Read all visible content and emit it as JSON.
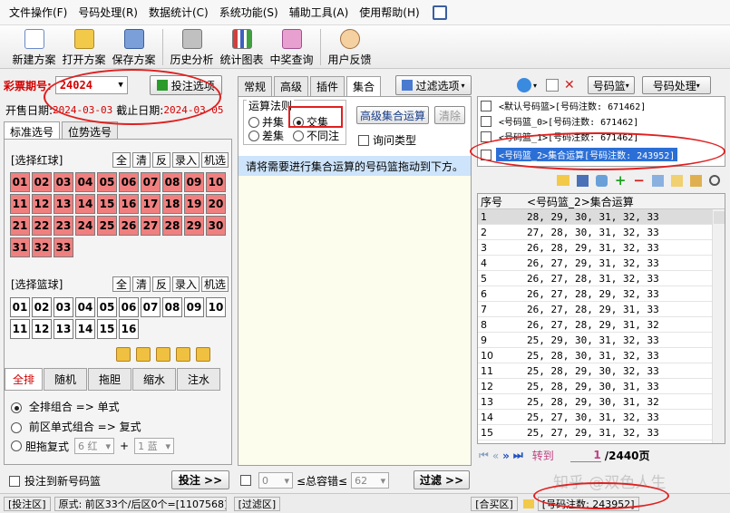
{
  "menu": [
    "文件操作(F)",
    "号码处理(R)",
    "数据统计(C)",
    "系统功能(S)",
    "辅助工具(A)",
    "使用帮助(H)"
  ],
  "toolbar": [
    "新建方案",
    "打开方案",
    "保存方案",
    "历史分析",
    "统计图表",
    "中奖查询",
    "用户反馈"
  ],
  "lottery": {
    "label": "彩票期号:",
    "issue": "24024",
    "button": "投注选项"
  },
  "dates": {
    "open_label": "开售日期:",
    "open_value": "2024-03-03",
    "close_label": "截止日期:",
    "close_value": "2024-03-05"
  },
  "left_tabs": [
    "标准选号",
    "位势选号"
  ],
  "red": {
    "label": "[选择红球]",
    "buttons": [
      "全",
      "清",
      "反",
      "录入",
      "机选"
    ],
    "balls": [
      "01",
      "02",
      "03",
      "04",
      "05",
      "06",
      "07",
      "08",
      "09",
      "10",
      "11",
      "12",
      "13",
      "14",
      "15",
      "16",
      "17",
      "18",
      "19",
      "20",
      "21",
      "22",
      "23",
      "24",
      "25",
      "26",
      "27",
      "28",
      "29",
      "30",
      "31",
      "32",
      "33"
    ]
  },
  "blue": {
    "label": "[选择篮球]",
    "buttons": [
      "全",
      "清",
      "反",
      "录入",
      "机选"
    ],
    "balls": [
      "01",
      "02",
      "03",
      "04",
      "05",
      "06",
      "07",
      "08",
      "09",
      "10",
      "11",
      "12",
      "13",
      "14",
      "15",
      "16"
    ]
  },
  "bottom_tabs": [
    "全排",
    "随机",
    "拖胆",
    "缩水",
    "注水"
  ],
  "options": {
    "opt1": "全排组合 => 单式",
    "opt2": "前区单式组合 => 复式",
    "opt3": "胆拖复式",
    "red_count": "6 红",
    "plus": "+",
    "blue_count": "1 蓝"
  },
  "bet": {
    "checkbox_label": "投注到新号码篮",
    "button": "投注 >>"
  },
  "center_tabs": [
    "常规",
    "高级",
    "插件",
    "集合"
  ],
  "filter_button": "过滤选项",
  "operation": {
    "group_label": "运算法则",
    "union": "并集",
    "intersect": "交集",
    "diff": "差集",
    "distinct": "不同注",
    "advanced_button": "高级集合运算",
    "clear_button": "清除",
    "ask_type": "询问类型",
    "hint": "请将需要进行集合运算的号码篮拖动到下方。"
  },
  "filter_row": {
    "value1": "0",
    "tolerance": "≤总容错≤",
    "value2": "62",
    "button": "过滤 >>"
  },
  "right_toolbar": {
    "basket": "号码篮",
    "process": "号码处理"
  },
  "baskets": [
    "<默认号码篮>[号码注数: 671462]",
    "<号码篮_0>[号码注数: 671462]",
    "<号码篮_1>[号码注数: 671462]",
    "<号码篮_2>集合运算[号码注数: 243952]"
  ],
  "table": {
    "head_no": "序号",
    "head_name": "<号码篮_2>集合运算",
    "rows": [
      [
        "1",
        "28, 29, 30, 31, 32, 33"
      ],
      [
        "2",
        "27, 28, 30, 31, 32, 33"
      ],
      [
        "3",
        "26, 28, 29, 31, 32, 33"
      ],
      [
        "4",
        "26, 27, 29, 31, 32, 33"
      ],
      [
        "5",
        "26, 27, 28, 31, 32, 33"
      ],
      [
        "6",
        "26, 27, 28, 29, 32, 33"
      ],
      [
        "7",
        "26, 27, 28, 29, 31, 33"
      ],
      [
        "8",
        "26, 27, 28, 29, 31, 32"
      ],
      [
        "9",
        "25, 29, 30, 31, 32, 33"
      ],
      [
        "10",
        "25, 28, 30, 31, 32, 33"
      ],
      [
        "11",
        "25, 28, 29, 30, 32, 33"
      ],
      [
        "12",
        "25, 28, 29, 30, 31, 33"
      ],
      [
        "13",
        "25, 28, 29, 30, 31, 32"
      ],
      [
        "14",
        "25, 27, 30, 31, 32, 33"
      ],
      [
        "15",
        "25, 27, 29, 31, 32, 33"
      ]
    ]
  },
  "pager": {
    "goto": "转到",
    "current": "1",
    "total": "/2440页"
  },
  "status": {
    "bet_area": "[投注区]",
    "detail": "原式: 前区33个/后区0个=[1107568]",
    "filter_area": "[过滤区]",
    "basket_area": "[合买区]",
    "count": "[号码注数: 243952]"
  },
  "watermark": "知乎 @双色人生",
  "colors": {
    "red_ball": "#f08080",
    "accent_red": "#d40000",
    "selected_blue": "#2b6fd6"
  }
}
